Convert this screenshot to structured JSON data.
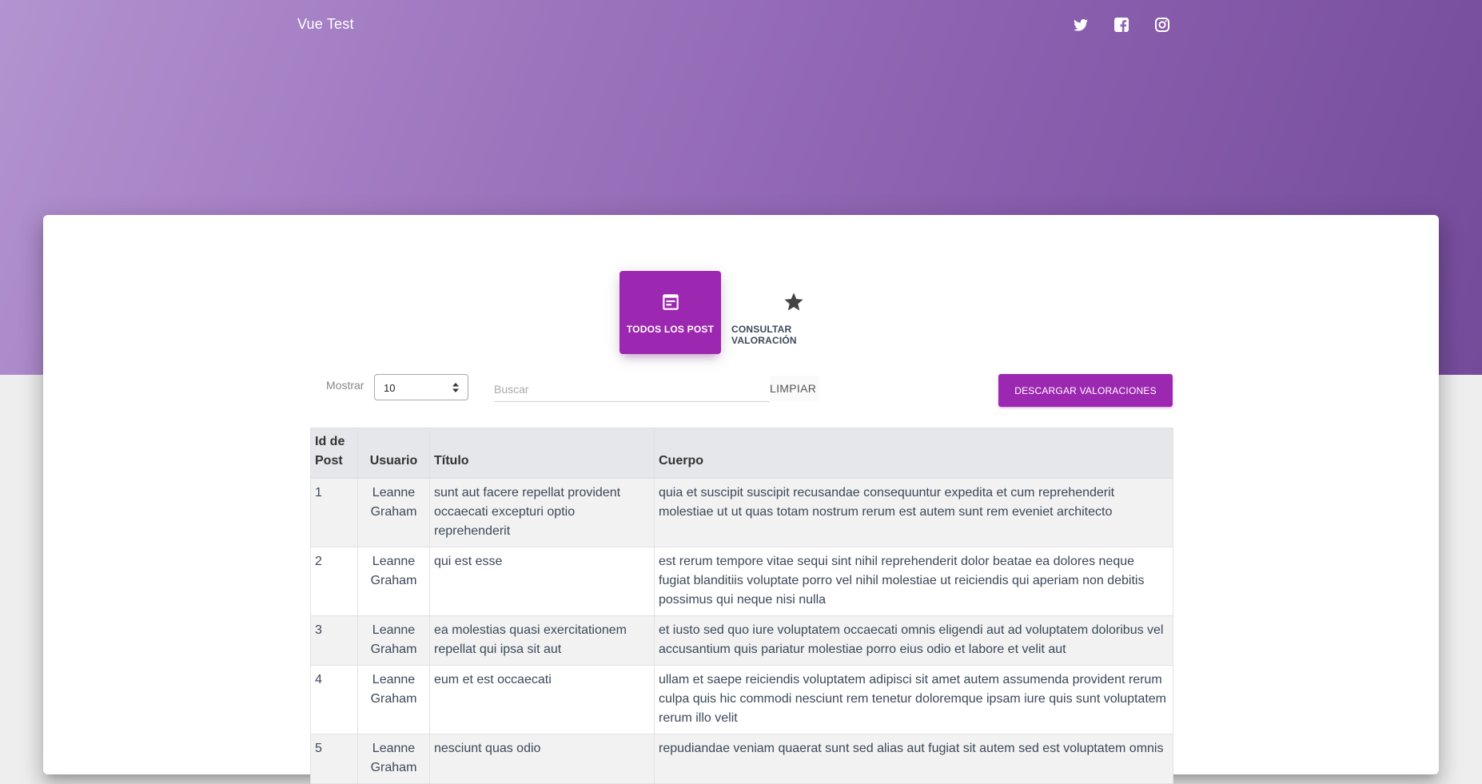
{
  "header": {
    "brand": "Vue Test",
    "social": [
      "twitter-icon",
      "facebook-icon",
      "instagram-icon"
    ]
  },
  "tabs": [
    {
      "label": "TODOS LOS POST",
      "icon": "post-icon",
      "active": true
    },
    {
      "label": "CONSULTAR VALORACIÓN",
      "icon": "star-icon",
      "active": false
    }
  ],
  "controls": {
    "show_label": "Mostrar",
    "show_value": "10",
    "search_placeholder": "Buscar",
    "clear_label": "LIMPIAR",
    "download_label": "DESCARGAR VALORACIONES"
  },
  "table": {
    "headers": {
      "id": "Id de Post",
      "user": "Usuario",
      "title": "Título",
      "body": "Cuerpo"
    },
    "rows": [
      {
        "id": "1",
        "user": "Leanne Graham",
        "title": "sunt aut facere repellat provident occaecati excepturi optio reprehenderit",
        "body": "quia et suscipit suscipit recusandae consequuntur expedita et cum reprehenderit molestiae ut ut quas totam nostrum rerum est autem sunt rem eveniet architecto"
      },
      {
        "id": "2",
        "user": "Leanne Graham",
        "title": "qui est esse",
        "body": "est rerum tempore vitae sequi sint nihil reprehenderit dolor beatae ea dolores neque fugiat blanditiis voluptate porro vel nihil molestiae ut reiciendis qui aperiam non debitis possimus qui neque nisi nulla"
      },
      {
        "id": "3",
        "user": "Leanne Graham",
        "title": "ea molestias quasi exercitationem repellat qui ipsa sit aut",
        "body": "et iusto sed quo iure voluptatem occaecati omnis eligendi aut ad voluptatem doloribus vel accusantium quis pariatur molestiae porro eius odio et labore et velit aut"
      },
      {
        "id": "4",
        "user": "Leanne Graham",
        "title": "eum et est occaecati",
        "body": "ullam et saepe reiciendis voluptatem adipisci sit amet autem assumenda provident rerum culpa quis hic commodi nesciunt rem tenetur doloremque ipsam iure quis sunt voluptatem rerum illo velit"
      },
      {
        "id": "5",
        "user": "Leanne Graham",
        "title": "nesciunt quas odio",
        "body": "repudiandae veniam quaerat sunt sed alias aut fugiat sit autem sed est voluptatem omnis"
      }
    ]
  },
  "colors": {
    "accent": "#9c27b0",
    "hero_start": "#b393d0",
    "hero_end": "#734b9a"
  }
}
